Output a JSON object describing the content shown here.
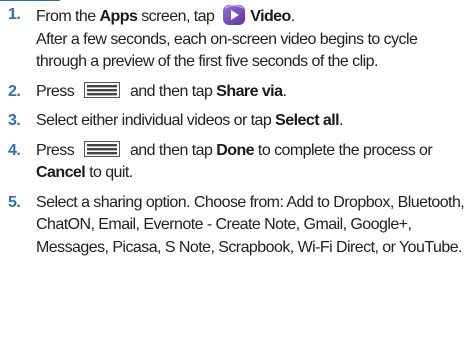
{
  "steps": [
    {
      "number": "1.",
      "lines": {
        "part1": "From the ",
        "apps_bold": "Apps",
        "part2": " screen, tap ",
        "icon": "video-app-icon",
        "video_bold": "Video",
        "part3": "."
      },
      "note": "After a few seconds, each on-screen video begins to cycle through a preview of the first five seconds of the clip."
    },
    {
      "number": "2.",
      "lines": {
        "part1": "Press ",
        "icon": "menu-key-icon",
        "part2": " and then tap ",
        "share_bold": "Share via",
        "part3": "."
      }
    },
    {
      "number": "3.",
      "lines": {
        "part1": "Select either individual videos or tap ",
        "select_all_bold": "Select all",
        "part2": "."
      }
    },
    {
      "number": "4.",
      "lines": {
        "part1": "Press ",
        "icon": "menu-key-icon",
        "part2": " and then tap ",
        "done_bold": "Done",
        "part3": " to complete the process or ",
        "cancel_bold": "Cancel",
        "part4": " to quit."
      }
    },
    {
      "number": "5.",
      "text": "Select a sharing option. Choose from: Add to Dropbox, Bluetooth, ChatON, Email, Evernote - Create Note, Gmail, Google+, Messages, Picasa, S Note, Scrapbook, Wi-Fi Direct, or YouTube."
    }
  ],
  "colors": {
    "accent": "#2b6fb5",
    "video_icon_bg": "#7b4fc2",
    "menu_icon": "#4a4a4a"
  }
}
